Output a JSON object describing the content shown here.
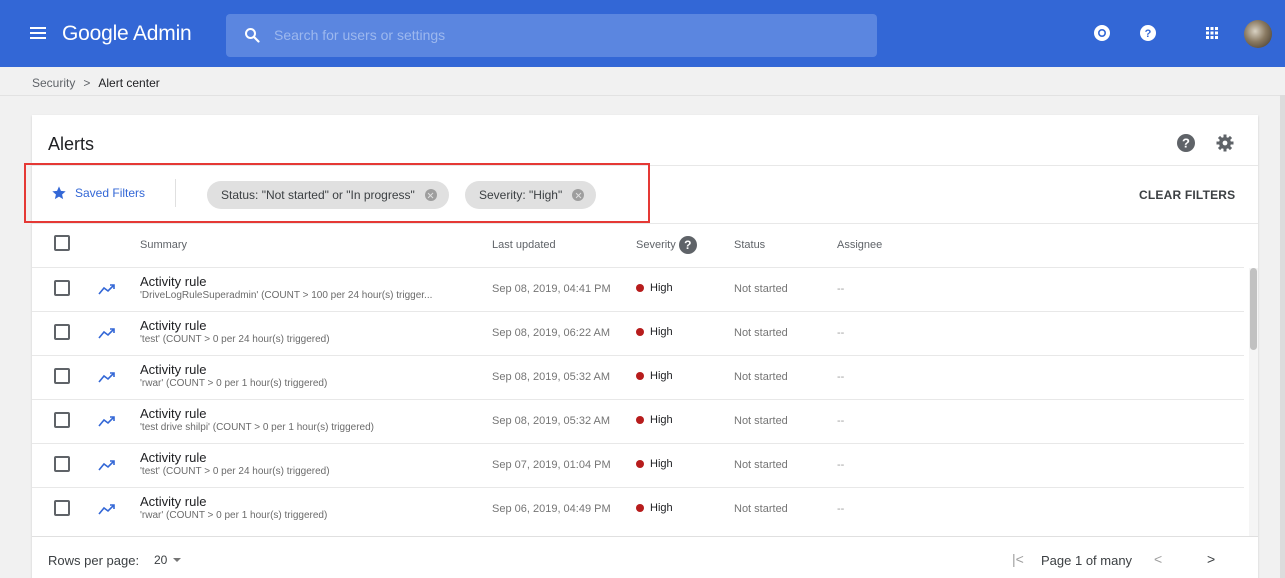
{
  "header": {
    "app_title": "Google Admin",
    "search_placeholder": "Search for users or settings",
    "icons": [
      "menu-icon",
      "search-icon",
      "support-icon",
      "help-icon",
      "apps-icon",
      "avatar"
    ]
  },
  "breadcrumb": {
    "parent": "Security",
    "separator": ">",
    "current": "Alert center"
  },
  "alerts_card": {
    "title": "Alerts",
    "saved_filters_label": "Saved Filters",
    "chips": [
      {
        "label": "Status: \"Not started\" or \"In progress\""
      },
      {
        "label": "Severity: \"High\""
      }
    ],
    "clear_filters_label": "CLEAR FILTERS",
    "columns": {
      "summary": "Summary",
      "last_updated": "Last updated",
      "severity": "Severity",
      "status": "Status",
      "assignee": "Assignee"
    },
    "rows": [
      {
        "title": "Activity rule",
        "detail": "'DriveLogRuleSuperadmin' (COUNT > 100 per 24 hour(s) trigger...",
        "updated": "Sep 08, 2019, 04:41 PM",
        "severity": "High",
        "status": "Not started",
        "assignee": "--"
      },
      {
        "title": "Activity rule",
        "detail": "'test' (COUNT > 0 per 24 hour(s) triggered)",
        "updated": "Sep 08, 2019, 06:22 AM",
        "severity": "High",
        "status": "Not started",
        "assignee": "--"
      },
      {
        "title": "Activity rule",
        "detail": "'rwar' (COUNT > 0 per 1 hour(s) triggered)",
        "updated": "Sep 08, 2019, 05:32 AM",
        "severity": "High",
        "status": "Not started",
        "assignee": "--"
      },
      {
        "title": "Activity rule",
        "detail": "'test drive shilpi' (COUNT > 0 per 1 hour(s) triggered)",
        "updated": "Sep 08, 2019, 05:32 AM",
        "severity": "High",
        "status": "Not started",
        "assignee": "--"
      },
      {
        "title": "Activity rule",
        "detail": "'test' (COUNT > 0 per 24 hour(s) triggered)",
        "updated": "Sep 07, 2019, 01:04 PM",
        "severity": "High",
        "status": "Not started",
        "assignee": "--"
      },
      {
        "title": "Activity rule",
        "detail": "'rwar' (COUNT > 0 per 1 hour(s) triggered)",
        "updated": "Sep 06, 2019, 04:49 PM",
        "severity": "High",
        "status": "Not started",
        "assignee": "--"
      }
    ]
  },
  "pagination": {
    "rows_per_page_label": "Rows per page:",
    "rows_per_page_value": "20",
    "page_label": "Page 1 of many",
    "first_glyph": "|<",
    "prev_glyph": "<",
    "next_glyph": ">"
  },
  "colors": {
    "header_bg": "#3367d6",
    "accent": "#3367d6",
    "highlight_border": "#e53935",
    "severity_high": "#b71c1c"
  }
}
